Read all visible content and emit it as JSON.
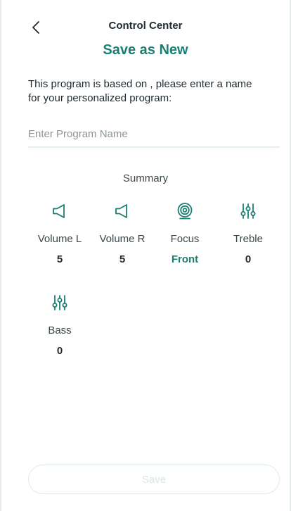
{
  "header": {
    "back_icon": "chevron-left-icon",
    "title": "Control Center"
  },
  "page": {
    "title": "Save as New",
    "description": "This program is based on , please enter a name for your personalized program:"
  },
  "name_input": {
    "value": "",
    "placeholder": "Enter Program Name"
  },
  "summary": {
    "title": "Summary",
    "items": [
      {
        "icon": "speaker-icon",
        "label": "Volume L",
        "value": "5"
      },
      {
        "icon": "speaker-icon",
        "label": "Volume R",
        "value": "5"
      },
      {
        "icon": "focus-icon",
        "label": "Focus",
        "value": "Front"
      },
      {
        "icon": "equalizer-icon",
        "label": "Treble",
        "value": "0"
      },
      {
        "icon": "equalizer-icon",
        "label": "Bass",
        "value": "0"
      }
    ]
  },
  "footer": {
    "save_label": "Save"
  },
  "colors": {
    "accent": "#1a7f72",
    "text": "#1f2a30",
    "muted": "#8a9499",
    "divider": "#e3efec",
    "disabled": "#d8e6e3"
  }
}
